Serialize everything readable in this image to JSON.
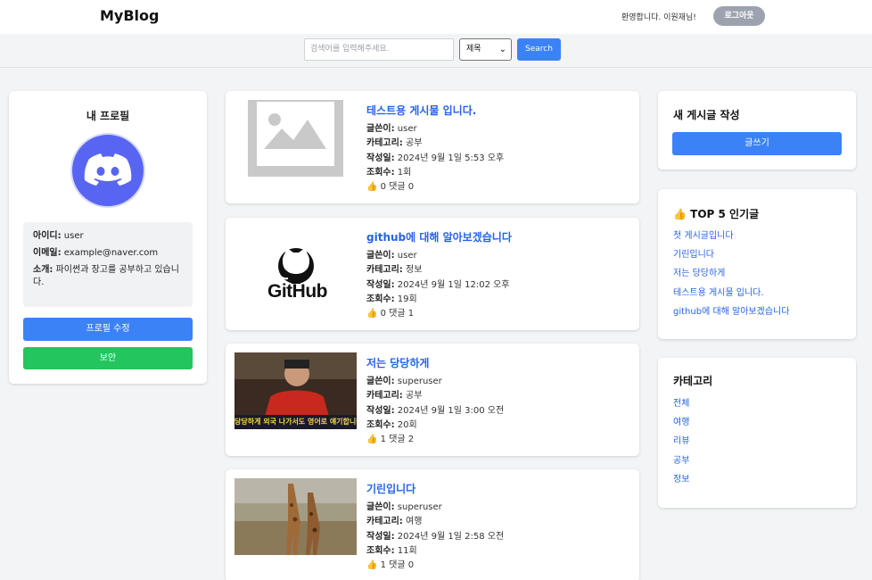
{
  "header": {
    "brand": "MyBlog",
    "welcome": "환영합니다. 이원재님!",
    "logout_label": "로그아웃"
  },
  "search": {
    "placeholder": "검색어를 입력해주세요.",
    "select_value": "제목",
    "button_label": "Search"
  },
  "profile": {
    "title": "내 프로필",
    "id_label": "아이디:",
    "id_value": "user",
    "email_label": "이메일:",
    "email_value": "example@naver.com",
    "intro_label": "소개:",
    "intro_value": "파이썬과 장고를 공부하고 있습니다.",
    "edit_label": "프로필 수정",
    "security_label": "보안"
  },
  "meta_labels": {
    "author": "글쓴이:",
    "category": "카테고리:",
    "date": "작성일:",
    "views": "조회수:"
  },
  "posts": [
    {
      "title": "테스트용 게시물 입니다.",
      "author": "user",
      "category": "공부",
      "date": "2024년 9월 1일 5:53 오후",
      "views": "1회",
      "likes": "0",
      "comments": "댓글 0",
      "thumb": "placeholder-image"
    },
    {
      "title": "github에 대해 알아보겠습니다",
      "author": "user",
      "category": "정보",
      "date": "2024년 9월 1일 12:02 오후",
      "views": "19회",
      "likes": "0",
      "comments": "댓글 1",
      "thumb": "github-logo",
      "thumb_text": "GitHub"
    },
    {
      "title": "저는 당당하게",
      "author": "superuser",
      "category": "공부",
      "date": "2024년 9월 1일 3:00 오전",
      "views": "20회",
      "likes": "1",
      "comments": "댓글 2",
      "thumb": "tv-screenshot",
      "thumb_caption": "당당하게 외국 나가서도 영어로 얘기합니다"
    },
    {
      "title": "기린입니다",
      "author": "superuser",
      "category": "여행",
      "date": "2024년 9월 1일 2:58 오전",
      "views": "11회",
      "likes": "1",
      "comments": "댓글 0",
      "thumb": "giraffe-photo"
    }
  ],
  "write": {
    "title": "새 게시글 작성",
    "button_label": "글쓰기"
  },
  "top5": {
    "title": "TOP 5 인기글",
    "items": [
      "첫 게시글입니다",
      "기린입니다",
      "저는 당당하게",
      "테스트용 게시물 입니다.",
      "github에 대해 알아보겠습니다"
    ]
  },
  "categories": {
    "title": "카테고리",
    "items": [
      "전체",
      "여행",
      "리뷰",
      "공부",
      "정보"
    ]
  },
  "colors": {
    "primary": "#3b82f6",
    "success": "#22c55e",
    "link": "#2563eb",
    "logout": "#9ca3af",
    "discord": "#5865f2"
  }
}
